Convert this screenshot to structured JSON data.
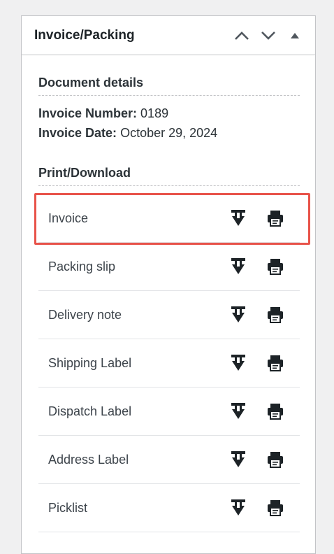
{
  "panel": {
    "title": "Invoice/Packing",
    "controls": [
      "chevron-up-icon",
      "chevron-down-icon",
      "triangle-up-icon"
    ]
  },
  "document_details": {
    "heading": "Document details",
    "invoice_number_label": "Invoice Number:",
    "invoice_number": "0189",
    "invoice_date_label": "Invoice Date:",
    "invoice_date": "October 29, 2024"
  },
  "print_download": {
    "heading": "Print/Download",
    "documents": [
      {
        "label": "Invoice",
        "highlighted": true
      },
      {
        "label": "Packing slip"
      },
      {
        "label": "Delivery note"
      },
      {
        "label": "Shipping Label"
      },
      {
        "label": "Dispatch Label"
      },
      {
        "label": "Address Label"
      },
      {
        "label": "Picklist"
      }
    ],
    "actions": [
      "download-icon",
      "print-icon"
    ]
  },
  "colors": {
    "highlight": "#e8534a",
    "border": "#c3c4c7",
    "text": "#1d2327"
  }
}
